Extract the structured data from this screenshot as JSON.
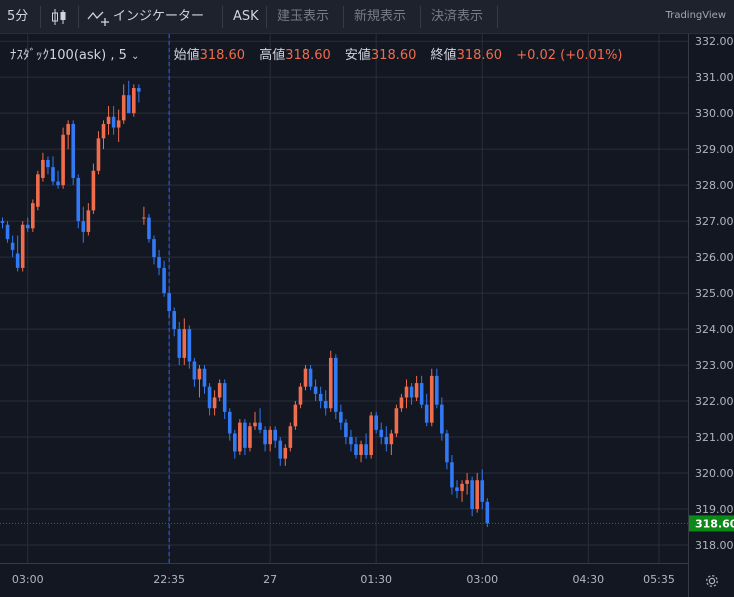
{
  "toolbar": {
    "interval": "5分",
    "indicator_label": "インジケーター",
    "price_side": "ASK",
    "buttons": [
      "建玉表示",
      "新規表示",
      "決済表示"
    ],
    "brand": "TradingView"
  },
  "legend": {
    "symbol": "ﾅｽﾀﾞｯｸ100(ask) , 5",
    "open_label": "始値",
    "open": "318.60",
    "high_label": "高値",
    "high": "318.60",
    "low_label": "安値",
    "low": "318.60",
    "close_label": "終値",
    "close": "318.60",
    "change": "+0.02 (+0.01%)"
  },
  "colors": {
    "background": "#131722",
    "grid": "#2a2e39",
    "up": "#ef6c4c",
    "down": "#3179f5",
    "price_badge": "#0c8a17",
    "crosshair": "#2962ff"
  },
  "icons": [
    "chevron-down-icon",
    "candles-icon",
    "indicator-icon",
    "gear-icon"
  ],
  "chart_data": {
    "type": "candlestick",
    "title": "ﾅｽﾀﾞｯｸ100(ask) , 5",
    "ylim": [
      317.5,
      332.2
    ],
    "y_ticks": [
      "332.00",
      "331.00",
      "330.00",
      "329.00",
      "328.00",
      "327.00",
      "326.00",
      "325.00",
      "324.00",
      "323.00",
      "322.00",
      "321.00",
      "320.00",
      "319.00",
      "318.00"
    ],
    "x_tick_labels": [
      "03:00",
      "22:35",
      "27",
      "01:30",
      "03:00",
      "04:30",
      "05:35"
    ],
    "x_tick_bar_index": [
      5,
      33,
      53,
      74,
      95,
      116,
      130
    ],
    "crosshair_bar_index": 33,
    "last_price": "318.60",
    "last_price_line": "dotted",
    "grid": true,
    "candles": [
      [
        327.0,
        327.1,
        326.8,
        326.95
      ],
      [
        326.9,
        327.0,
        326.4,
        326.5
      ],
      [
        326.4,
        326.6,
        326.0,
        326.2
      ],
      [
        326.1,
        326.6,
        325.6,
        325.7
      ],
      [
        325.7,
        327.0,
        325.6,
        326.9
      ],
      [
        326.9,
        327.1,
        326.7,
        326.8
      ],
      [
        326.8,
        327.6,
        326.7,
        327.5
      ],
      [
        327.4,
        328.4,
        327.3,
        328.3
      ],
      [
        328.2,
        328.9,
        328.1,
        328.7
      ],
      [
        328.7,
        328.8,
        328.3,
        328.5
      ],
      [
        328.5,
        328.8,
        328.0,
        328.1
      ],
      [
        328.1,
        328.4,
        327.9,
        328.0
      ],
      [
        328.0,
        329.6,
        327.9,
        329.4
      ],
      [
        329.4,
        329.8,
        329.0,
        329.7
      ],
      [
        329.7,
        329.8,
        328.0,
        328.2
      ],
      [
        328.2,
        328.3,
        326.8,
        327.0
      ],
      [
        327.0,
        327.4,
        326.4,
        326.7
      ],
      [
        326.7,
        327.5,
        326.6,
        327.3
      ],
      [
        327.3,
        328.6,
        327.2,
        328.4
      ],
      [
        328.4,
        329.5,
        328.3,
        329.3
      ],
      [
        329.3,
        329.8,
        329.0,
        329.7
      ],
      [
        329.7,
        330.2,
        329.4,
        329.9
      ],
      [
        329.9,
        330.2,
        329.4,
        329.6
      ],
      [
        329.6,
        330.1,
        329.2,
        329.8
      ],
      [
        329.8,
        330.8,
        329.7,
        330.5
      ],
      [
        330.5,
        330.9,
        330.0,
        330.0
      ],
      [
        330.0,
        330.8,
        329.9,
        330.7
      ],
      [
        330.7,
        330.8,
        330.3,
        330.6
      ],
      [
        327.1,
        327.4,
        326.9,
        327.1
      ],
      [
        327.1,
        327.2,
        326.4,
        326.5
      ],
      [
        326.5,
        326.6,
        325.8,
        326.0
      ],
      [
        326.0,
        326.2,
        325.5,
        325.7
      ],
      [
        325.7,
        325.9,
        324.9,
        325.0
      ],
      [
        325.0,
        325.1,
        324.3,
        324.5
      ],
      [
        324.5,
        324.6,
        323.8,
        324.0
      ],
      [
        324.0,
        324.2,
        323.0,
        323.2
      ],
      [
        323.2,
        324.3,
        323.0,
        324.0
      ],
      [
        324.0,
        324.1,
        322.9,
        323.1
      ],
      [
        323.1,
        323.2,
        322.4,
        322.6
      ],
      [
        322.6,
        323.0,
        322.1,
        322.9
      ],
      [
        322.9,
        323.0,
        322.2,
        322.4
      ],
      [
        322.4,
        322.5,
        321.6,
        321.8
      ],
      [
        321.8,
        322.3,
        321.6,
        322.1
      ],
      [
        322.1,
        322.6,
        322.0,
        322.5
      ],
      [
        322.5,
        322.6,
        321.5,
        321.7
      ],
      [
        321.7,
        321.8,
        320.9,
        321.1
      ],
      [
        321.1,
        321.2,
        320.4,
        320.6
      ],
      [
        320.6,
        321.5,
        320.5,
        321.4
      ],
      [
        321.4,
        321.5,
        320.5,
        320.7
      ],
      [
        320.7,
        321.4,
        320.6,
        321.3
      ],
      [
        321.3,
        321.7,
        321.2,
        321.4
      ],
      [
        321.4,
        321.8,
        321.1,
        321.2
      ],
      [
        321.2,
        321.3,
        320.6,
        320.8
      ],
      [
        320.8,
        321.3,
        320.6,
        321.2
      ],
      [
        321.2,
        321.3,
        320.7,
        320.9
      ],
      [
        320.9,
        321.0,
        320.2,
        320.4
      ],
      [
        320.4,
        320.8,
        320.2,
        320.7
      ],
      [
        320.7,
        321.4,
        320.6,
        321.3
      ],
      [
        321.3,
        322.0,
        321.2,
        321.9
      ],
      [
        321.9,
        322.5,
        321.8,
        322.4
      ],
      [
        322.4,
        323.0,
        322.3,
        322.9
      ],
      [
        322.9,
        323.0,
        322.3,
        322.4
      ],
      [
        322.4,
        322.6,
        322.0,
        322.2
      ],
      [
        322.2,
        322.4,
        321.8,
        322.0
      ],
      [
        322.0,
        322.3,
        321.6,
        321.8
      ],
      [
        321.8,
        323.4,
        321.7,
        323.2
      ],
      [
        323.2,
        323.3,
        321.5,
        321.7
      ],
      [
        321.7,
        321.9,
        321.2,
        321.4
      ],
      [
        321.4,
        321.5,
        320.8,
        321.0
      ],
      [
        321.0,
        321.2,
        320.6,
        320.8
      ],
      [
        320.8,
        321.0,
        320.4,
        320.5
      ],
      [
        320.5,
        320.9,
        320.3,
        320.8
      ],
      [
        320.8,
        321.1,
        320.4,
        320.5
      ],
      [
        320.5,
        321.7,
        320.4,
        321.6
      ],
      [
        321.6,
        321.7,
        321.1,
        321.2
      ],
      [
        321.2,
        321.4,
        320.8,
        321.0
      ],
      [
        321.0,
        321.3,
        320.6,
        320.8
      ],
      [
        320.8,
        321.2,
        320.5,
        321.1
      ],
      [
        321.1,
        321.9,
        321.0,
        321.8
      ],
      [
        321.8,
        322.2,
        321.7,
        322.1
      ],
      [
        322.1,
        322.6,
        321.8,
        322.4
      ],
      [
        322.4,
        322.5,
        321.9,
        322.1
      ],
      [
        322.1,
        322.7,
        322.0,
        322.5
      ],
      [
        322.5,
        322.7,
        321.8,
        321.9
      ],
      [
        321.9,
        322.2,
        321.3,
        321.4
      ],
      [
        321.4,
        322.9,
        321.3,
        322.7
      ],
      [
        322.7,
        322.9,
        321.8,
        321.9
      ],
      [
        321.9,
        322.1,
        320.9,
        321.1
      ],
      [
        321.1,
        321.2,
        320.1,
        320.3
      ],
      [
        320.3,
        320.5,
        319.4,
        319.6
      ],
      [
        319.6,
        319.8,
        319.3,
        319.5
      ],
      [
        319.5,
        319.8,
        319.2,
        319.7
      ],
      [
        319.7,
        320.0,
        319.4,
        319.8
      ],
      [
        319.8,
        319.9,
        318.8,
        319.0
      ],
      [
        319.0,
        320.0,
        318.9,
        319.8
      ],
      [
        319.8,
        320.1,
        319.0,
        319.2
      ],
      [
        319.2,
        319.3,
        318.5,
        318.6
      ]
    ]
  }
}
